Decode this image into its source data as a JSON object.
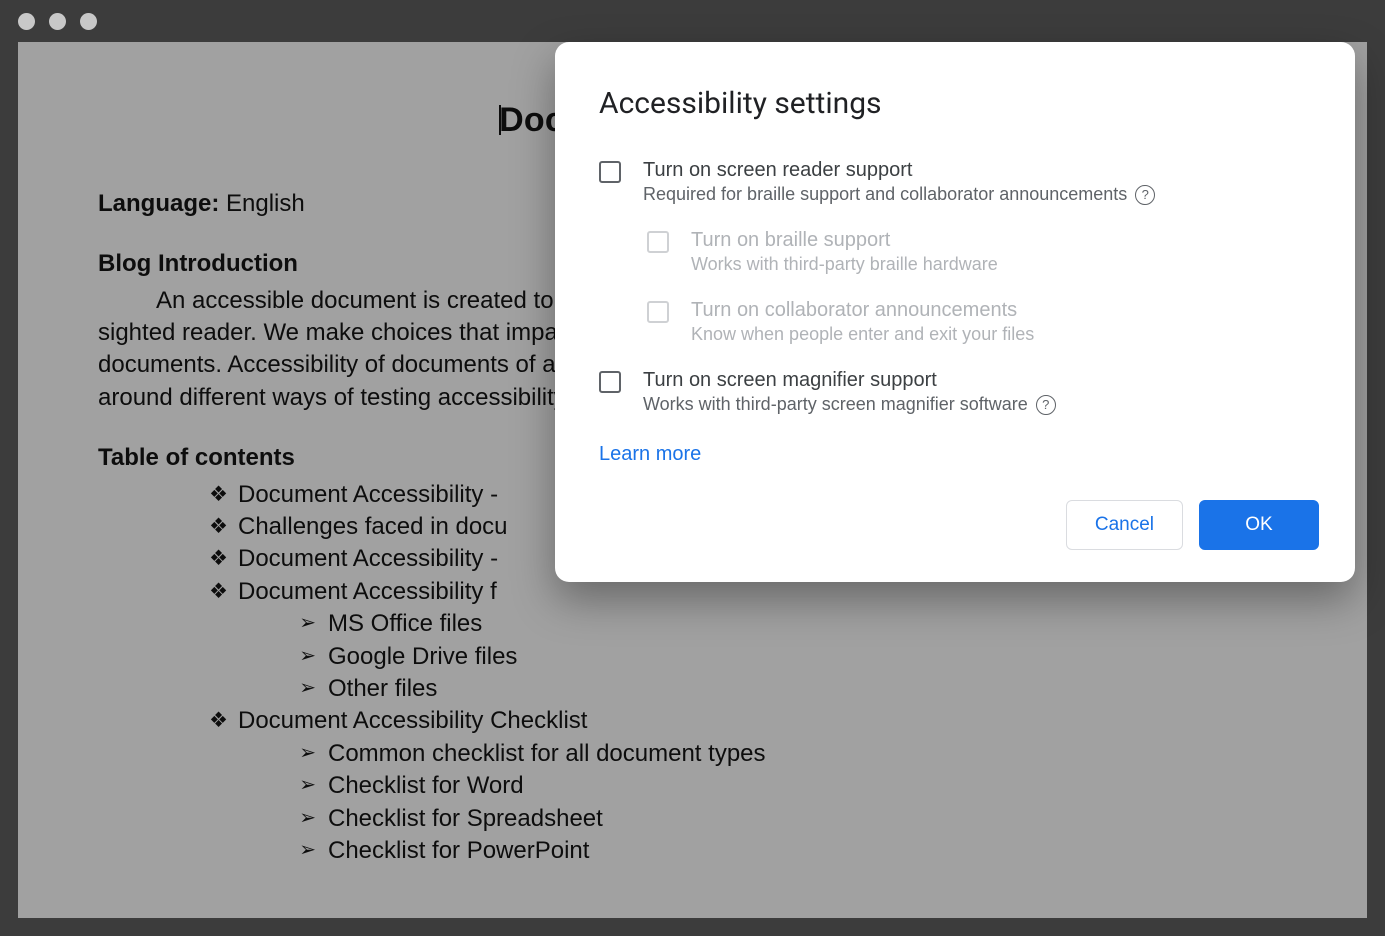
{
  "document": {
    "title_prefix": "Docum",
    "title_full": "Document Accessibility",
    "language_label": "Language:",
    "language_value": "English",
    "blog_heading": "Blog Introduction",
    "blog_paragraph": "An accessible document is created to be as easily readable by a sighted reader as a low-vision or non-sighted reader. We make choices that impact accessibility as we are in the initial stages of creating electronic documents. Accessibility of documents of all types like word, spreadsheet, slides, and PDF. We are covering around different ways of testing accessibility of different types of documents.",
    "toc_heading": "Table of contents",
    "toc": [
      {
        "label": "Document Accessibility -",
        "children": []
      },
      {
        "label": "Challenges faced in docu",
        "children": []
      },
      {
        "label": "Document Accessibility -",
        "children": []
      },
      {
        "label": "Document Accessibility f",
        "children": [
          {
            "label": "MS Office files"
          },
          {
            "label": "Google Drive files"
          },
          {
            "label": "Other files"
          }
        ]
      },
      {
        "label": "Document Accessibility Checklist",
        "children": [
          {
            "label": "Common checklist for all document types"
          },
          {
            "label": "Checklist for Word"
          },
          {
            "label": "Checklist for Spreadsheet"
          },
          {
            "label": "Checklist for PowerPoint"
          }
        ]
      }
    ]
  },
  "dialog": {
    "title": "Accessibility settings",
    "options": {
      "screen_reader": {
        "label": "Turn on screen reader support",
        "desc": "Required for braille support and collaborator announcements",
        "checked": false,
        "disabled": false,
        "has_help": true
      },
      "braille": {
        "label": "Turn on braille support",
        "desc": "Works with third-party braille hardware",
        "checked": false,
        "disabled": true,
        "has_help": false
      },
      "collaborator": {
        "label": "Turn on collaborator announcements",
        "desc": "Know when people enter and exit your files",
        "checked": false,
        "disabled": true,
        "has_help": false
      },
      "magnifier": {
        "label": "Turn on screen magnifier support",
        "desc": "Works with third-party screen magnifier software",
        "checked": false,
        "disabled": false,
        "has_help": true
      }
    },
    "learn_more": "Learn more",
    "cancel_label": "Cancel",
    "ok_label": "OK"
  }
}
